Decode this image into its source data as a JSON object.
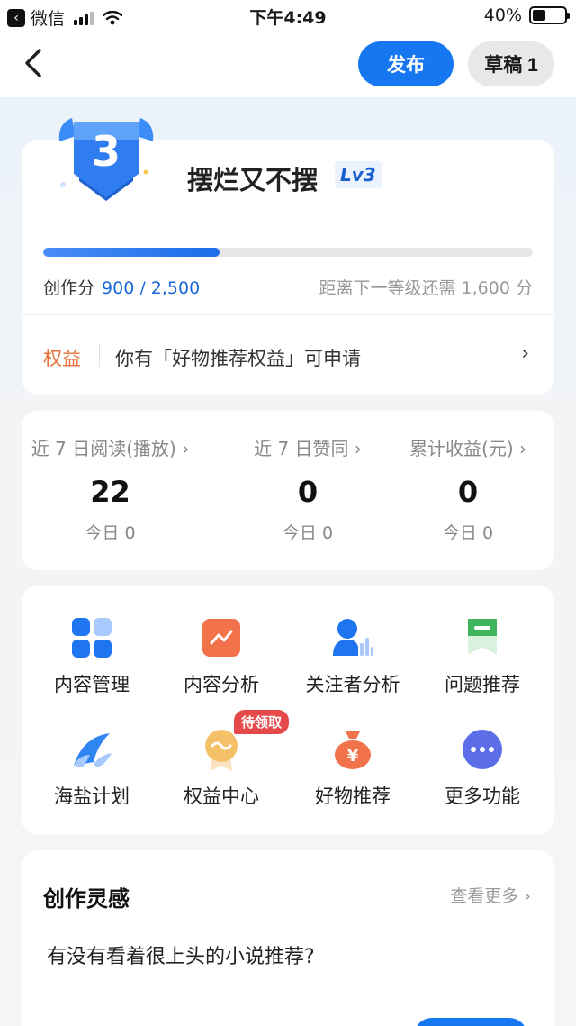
{
  "status_bar": {
    "app_name": "微信",
    "time": "下午4:49",
    "battery_text": "40%",
    "battery_level": 0.4
  },
  "nav": {
    "publish_label": "发布",
    "draft_label": "草稿 1"
  },
  "level_card": {
    "level_number": "3",
    "username": "摆烂又不摆",
    "level_tag": "Lv3",
    "score_label": "创作分",
    "score_value": "900 / 2,500",
    "progress_fraction": 0.36,
    "next_level_text": "距离下一等级还需 1,600 分",
    "rights_label": "权益",
    "rights_text": "你有「好物推荐权益」可申请",
    "rights_arrow": "›"
  },
  "stats": [
    {
      "label": "近 7 日阅读(播放) ›",
      "value": "22",
      "today": "今日  0"
    },
    {
      "label": "近 7 日赞同 ›",
      "value": "0",
      "today": "今日  0"
    },
    {
      "label": "累计收益(元) ›",
      "value": "0",
      "today": "今日  0"
    }
  ],
  "tools": {
    "items": [
      {
        "label": "内容管理",
        "icon": "grid-icon"
      },
      {
        "label": "内容分析",
        "icon": "chart-icon"
      },
      {
        "label": "关注者分析",
        "icon": "follower-icon"
      },
      {
        "label": "问题推荐",
        "icon": "bookmark-icon"
      },
      {
        "label": "海盐计划",
        "icon": "wave-icon"
      },
      {
        "label": "权益中心",
        "icon": "medal-icon"
      },
      {
        "label": "好物推荐",
        "icon": "money-bag-icon"
      },
      {
        "label": "更多功能",
        "icon": "more-icon"
      }
    ],
    "pending_badge": "待领取"
  },
  "inspiration": {
    "title": "创作灵感",
    "more_label": "查看更多 ›",
    "question": "有没有看着很上头的小说推荐?"
  },
  "colors": {
    "accent": "#1677f0",
    "rights_orange": "#e8703b",
    "badge_red": "#e54949"
  }
}
